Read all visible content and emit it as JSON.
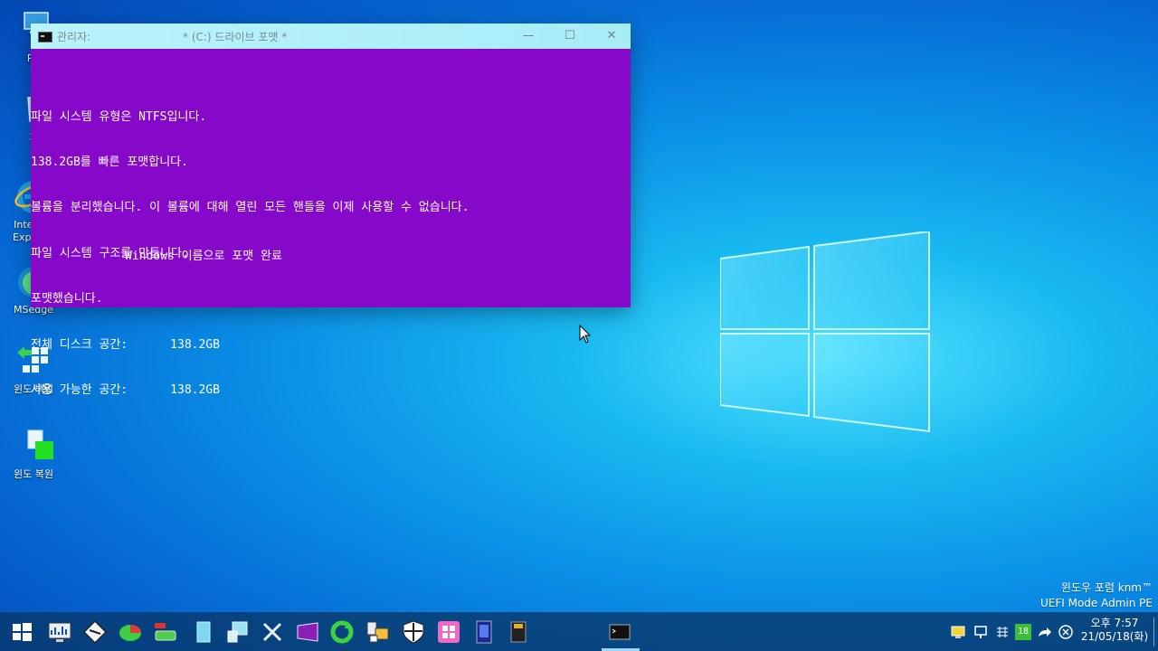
{
  "window": {
    "title_prefix": "관리자:",
    "title": "* (C:) 드라이브 포맷 *",
    "controls": {
      "minimize": "—",
      "maximize": "☐",
      "close": "✕"
    },
    "lines": [
      "파일 시스템 유형은 NTFS입니다.",
      "138.2GB를 빠른 포맷합니다.",
      "볼륨을 분리했습니다. 이 볼륨에 대해 열린 모든 핸들을 이제 사용할 수 없습니다.",
      "파일 시스템 구조를 만듭니다.",
      "포맷했습니다.",
      "전체 디스크 공간:      138.2GB",
      "사용 가능한 공간:      138.2GB"
    ],
    "final_message": "Windows 이름으로 포맷 완료"
  },
  "desktop": {
    "icons": [
      {
        "name": "pc",
        "label": "PC"
      },
      {
        "name": "recycle-bin",
        "label": "휴"
      },
      {
        "name": "internet-explorer",
        "label": "Internet Explorer"
      },
      {
        "name": "msedge",
        "label": "MSedge"
      },
      {
        "name": "backup",
        "label": "윈도 백업"
      },
      {
        "name": "restore",
        "label": "윈도 복원"
      }
    ],
    "watermark": {
      "line1": "윈도우 포럼 knm™",
      "line2": "UEFI Mode Admin PE"
    }
  },
  "taskbar": {
    "tray_badge": "18",
    "clock": {
      "time": "오후 7:57",
      "date": "21/05/18(화)"
    }
  }
}
